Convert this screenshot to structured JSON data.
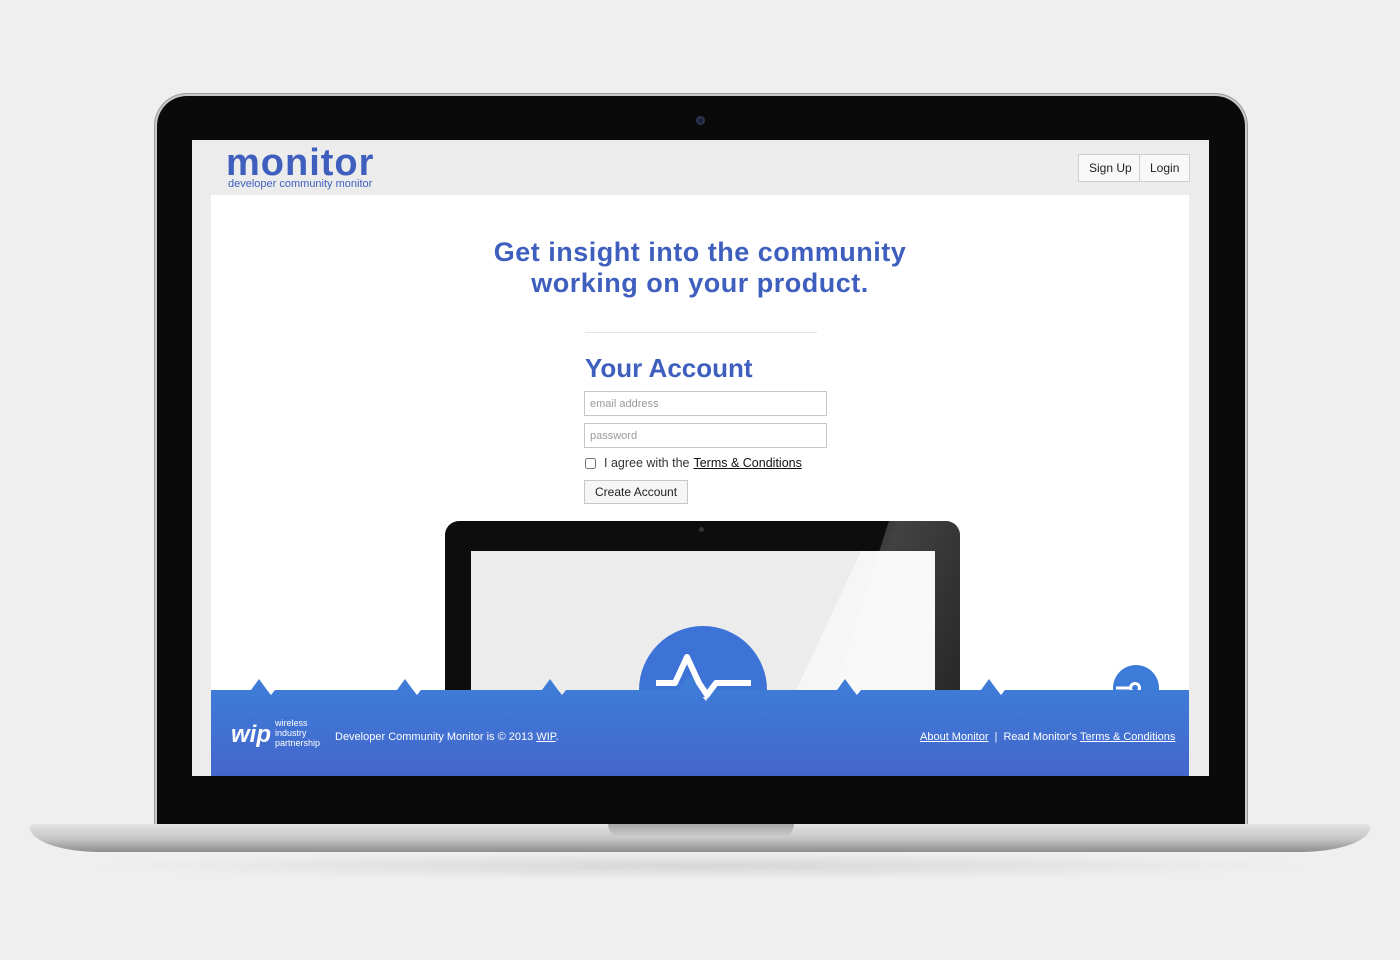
{
  "brand": {
    "logo_text": "monitor",
    "tagline": "developer community monitor",
    "color": "#3f5fbf"
  },
  "nav": {
    "signup_label": "Sign Up",
    "login_label": "Login"
  },
  "hero": {
    "line1": "Get insight into the community",
    "line2": "working on your product."
  },
  "account_form": {
    "title": "Your Account",
    "email_placeholder": "email address",
    "password_placeholder": "password",
    "agree_text": "I agree with the",
    "terms_link": "Terms & Conditions",
    "agree_checked": false,
    "submit_label": "Create Account"
  },
  "footer": {
    "partner_logo_text": "wip",
    "partner_name_line1": "wireless",
    "partner_name_line2": "industry",
    "partner_name_line3": "partnership",
    "copyright_prefix": "Developer Community Monitor is © 2013",
    "copyright_link": "WIP",
    "copyright_suffix": ".",
    "about_link": "About Monitor",
    "separator": "|",
    "read_prefix": "Read Monitor's",
    "terms_link": "Terms & Conditions",
    "gradient_top": "#3d7fd9",
    "gradient_bottom": "#4466cc"
  },
  "icons": {
    "illustration_logo": "monitor-pulse-icon",
    "corner_node": "pulse-node-icon"
  }
}
